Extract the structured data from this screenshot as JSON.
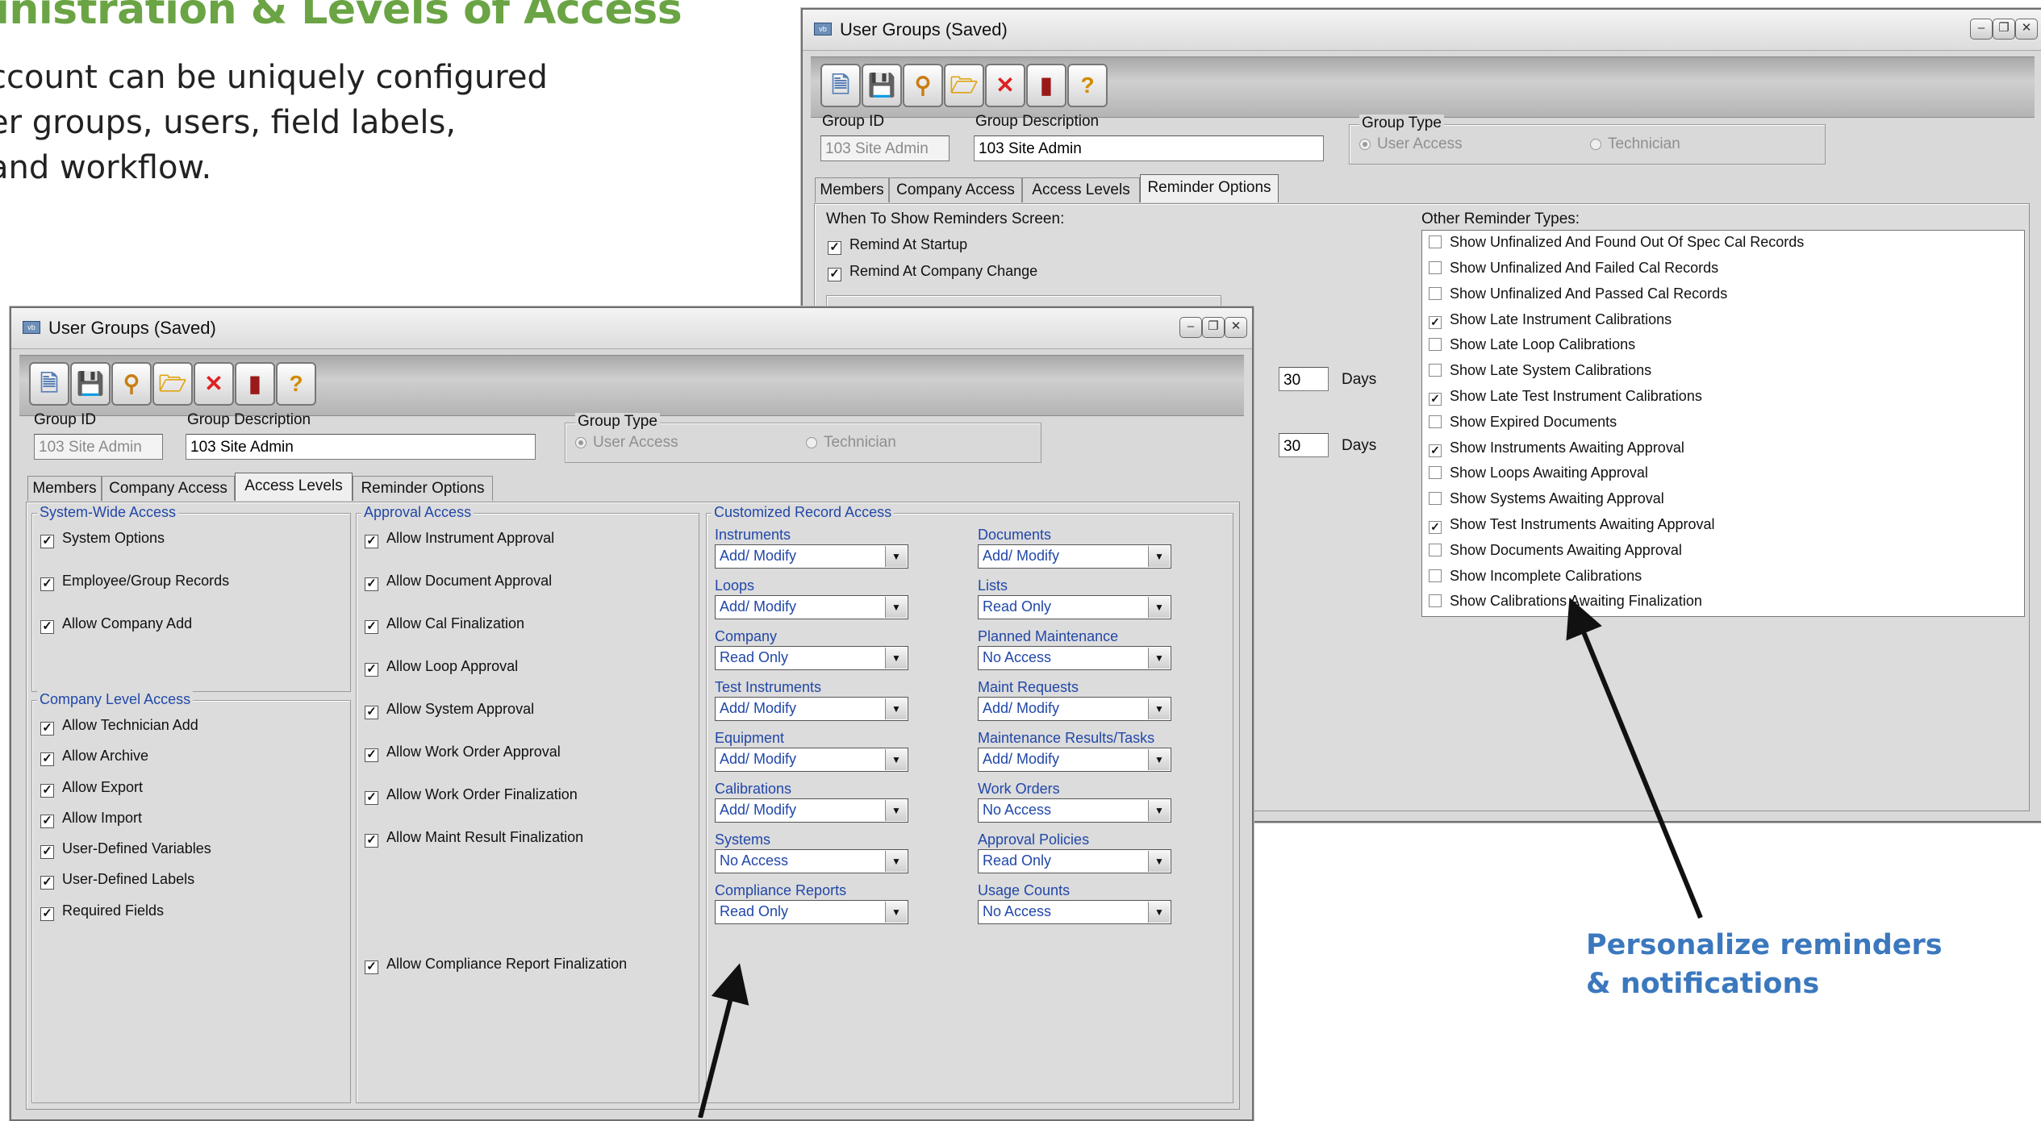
{
  "heading": "inistration & Levels of Access",
  "intro_lines": [
    "ccount can be uniquely configured",
    "er groups, users, field labels,",
    " and workflow."
  ],
  "callout_lines": [
    "Personalize reminders",
    "& notifications"
  ],
  "colors": {
    "heading": "#6aa444",
    "callout": "#3b78bd",
    "group_caption": "#2147a8"
  },
  "window": {
    "title": "User Groups (Saved)",
    "toolbar_icons": [
      "new-document-icon",
      "save-icon",
      "search-icon",
      "open-folder-icon",
      "delete-icon",
      "exit-icon",
      "help-icon"
    ],
    "labels": {
      "group_id": "Group ID",
      "group_description": "Group Description",
      "group_type": "Group Type"
    },
    "values": {
      "group_id": "103 Site Admin",
      "group_description": "103 Site Admin"
    },
    "group_type_options": [
      "User Access",
      "Technician"
    ],
    "tabs": [
      "Members",
      "Company Access",
      "Access Levels",
      "Reminder Options"
    ]
  },
  "back": {
    "when_label": "When To Show Reminders Screen:",
    "remind_options": [
      {
        "label": "Remind At Startup",
        "checked": true
      },
      {
        "label": "Remind At Company Change",
        "checked": true
      }
    ],
    "days_rows": [
      {
        "value": "30",
        "unit": "Days"
      },
      {
        "value": "30",
        "unit": "Days"
      }
    ],
    "other_label": "Other Reminder Types:",
    "reminder_types": [
      {
        "label": "Show Unfinalized And Found Out Of Spec Cal Records",
        "checked": false
      },
      {
        "label": "Show Unfinalized And Failed Cal Records",
        "checked": false
      },
      {
        "label": "Show Unfinalized And Passed Cal Records",
        "checked": false
      },
      {
        "label": "Show Late Instrument Calibrations",
        "checked": true
      },
      {
        "label": "Show Late Loop Calibrations",
        "checked": false
      },
      {
        "label": "Show Late System Calibrations",
        "checked": false
      },
      {
        "label": "Show Late Test Instrument Calibrations",
        "checked": true
      },
      {
        "label": "Show Expired Documents",
        "checked": false
      },
      {
        "label": "Show Instruments Awaiting Approval",
        "checked": true
      },
      {
        "label": "Show Loops Awaiting Approval",
        "checked": false
      },
      {
        "label": "Show Systems Awaiting Approval",
        "checked": false
      },
      {
        "label": "Show Test Instruments Awaiting Approval",
        "checked": true
      },
      {
        "label": "Show Documents Awaiting Approval",
        "checked": false
      },
      {
        "label": "Show Incomplete Calibrations",
        "checked": false
      },
      {
        "label": "Show Calibrations Awaiting Finalization",
        "checked": false
      }
    ]
  },
  "front": {
    "system_wide": {
      "caption": "System-Wide Access",
      "items": [
        "System Options",
        "Employee/Group Records",
        "Allow Company Add"
      ]
    },
    "company_level": {
      "caption": "Company Level Access",
      "items": [
        "Allow Technician Add",
        "Allow Archive",
        "Allow Export",
        "Allow Import",
        "User-Defined Variables",
        "User-Defined Labels",
        "Required Fields"
      ]
    },
    "approval": {
      "caption": "Approval Access",
      "items": [
        "Allow Instrument Approval",
        "Allow Document Approval",
        "Allow Cal Finalization",
        "Allow Loop Approval",
        "Allow System Approval",
        "Allow Work Order Approval",
        "Allow Work Order Finalization",
        "Allow Maint Result Finalization",
        "Allow Compliance Report Finalization"
      ]
    },
    "record_access": {
      "caption": "Customized Record Access",
      "left": [
        {
          "label": "Instruments",
          "value": "Add/ Modify"
        },
        {
          "label": "Loops",
          "value": "Add/ Modify"
        },
        {
          "label": "Company",
          "value": "Read Only"
        },
        {
          "label": "Test Instruments",
          "value": "Add/ Modify"
        },
        {
          "label": "Equipment",
          "value": "Add/ Modify"
        },
        {
          "label": "Calibrations",
          "value": "Add/ Modify"
        },
        {
          "label": "Systems",
          "value": "No Access"
        },
        {
          "label": "Compliance Reports",
          "value": "Read Only"
        }
      ],
      "right": [
        {
          "label": "Documents",
          "value": "Add/ Modify"
        },
        {
          "label": "Lists",
          "value": "Read Only"
        },
        {
          "label": "Planned Maintenance",
          "value": "No Access"
        },
        {
          "label": "Maint Requests",
          "value": "Add/ Modify"
        },
        {
          "label": "Maintenance Results/Tasks",
          "value": "Add/ Modify"
        },
        {
          "label": "Work Orders",
          "value": "No Access"
        },
        {
          "label": "Approval Policies",
          "value": "Read Only"
        },
        {
          "label": "Usage Counts",
          "value": "No Access"
        }
      ]
    }
  }
}
